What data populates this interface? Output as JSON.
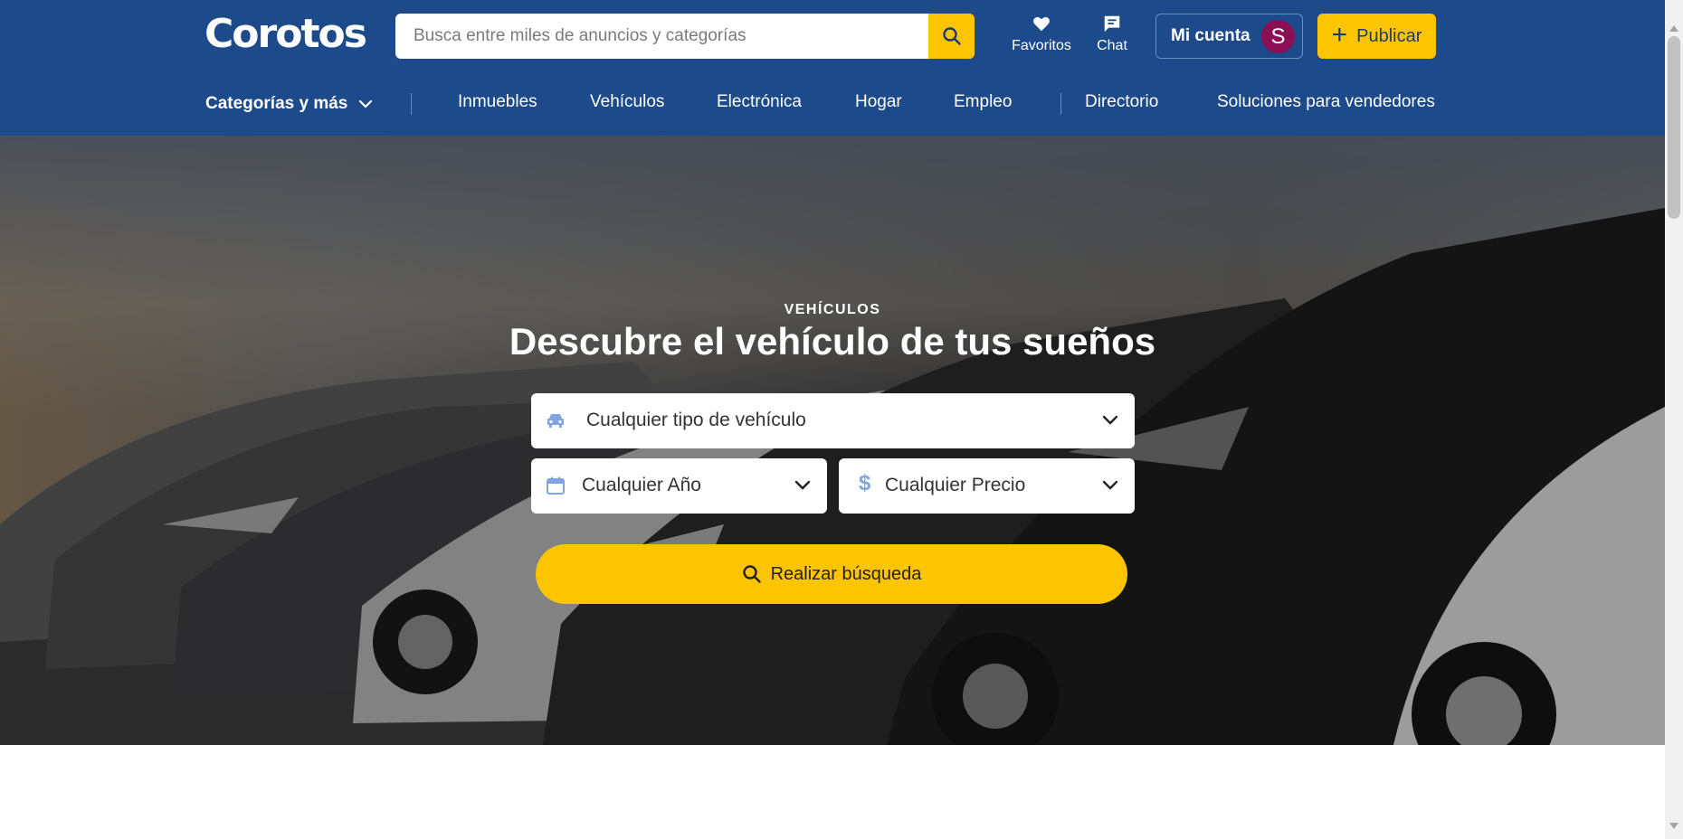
{
  "header": {
    "logo": "Corotos",
    "search": {
      "placeholder": "Busca entre miles de anuncios y categorías",
      "value": ""
    },
    "favorites_label": "Favoritos",
    "chat_label": "Chat",
    "account_label": "Mi cuenta",
    "avatar_initial": "S",
    "publish_label": "Publicar"
  },
  "nav": {
    "categories_label": "Categorías y más",
    "items": [
      "Inmuebles",
      "Vehículos",
      "Electrónica",
      "Hogar",
      "Empleo"
    ],
    "directory_label": "Directorio",
    "sellers_label": "Soluciones para vendedores"
  },
  "hero": {
    "eyebrow": "VEHÍCULOS",
    "title": "Descubre el vehículo de tus sueños",
    "vehicle_type": "Cualquier tipo de vehículo",
    "year": "Cualquier Año",
    "price": "Cualquier Precio",
    "search_button": "Realizar búsqueda"
  },
  "colors": {
    "header_bg": "#1d4a8a",
    "accent_yellow": "#fcc500",
    "avatar_bg": "#8a0f54",
    "field_icon": "#7fa6e0"
  },
  "icons": [
    "search-icon",
    "heart-icon",
    "chat-icon",
    "plus-icon",
    "chevron-down-icon",
    "car-icon",
    "calendar-icon",
    "dollar-icon"
  ]
}
